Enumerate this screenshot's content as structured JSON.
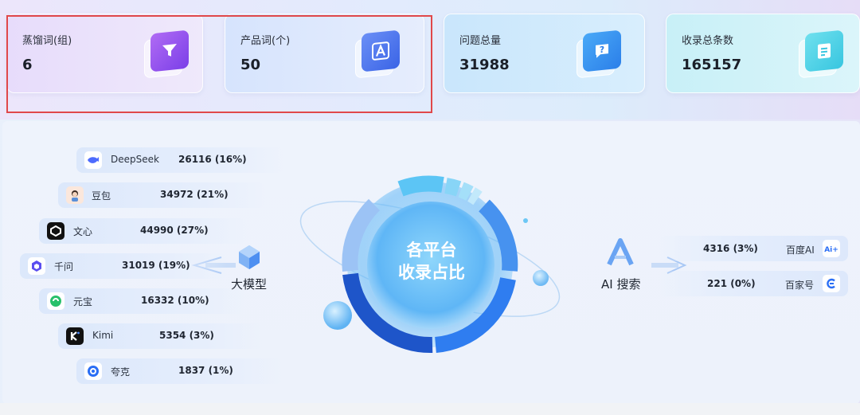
{
  "stats": [
    {
      "label": "蒸馏词(组)",
      "value": "6",
      "icon": "filter-icon"
    },
    {
      "label": "产品词(个)",
      "value": "50",
      "icon": "letter-a-icon"
    },
    {
      "label": "问题总量",
      "value": "31988",
      "icon": "question-icon"
    },
    {
      "label": "收录总条数",
      "value": "165157",
      "icon": "document-icon"
    }
  ],
  "center": {
    "line1": "各平台",
    "line2": "收录占比"
  },
  "left_group": {
    "label": "大模型",
    "platforms": [
      {
        "name": "DeepSeek",
        "value": "26116 (16%)",
        "icon": "deepseek-whale-icon"
      },
      {
        "name": "豆包",
        "value": "34972 (21%)",
        "icon": "doubao-avatar-icon"
      },
      {
        "name": "文心",
        "value": "44990 (27%)",
        "icon": "wenxin-icon"
      },
      {
        "name": "千问",
        "value": "31019 (19%)",
        "icon": "qianwen-icon"
      },
      {
        "name": "元宝",
        "value": "16332 (10%)",
        "icon": "yuanbao-icon"
      },
      {
        "name": "Kimi",
        "value": "5354 (3%)",
        "icon": "kimi-icon"
      },
      {
        "name": "夸克",
        "value": "1837 (1%)",
        "icon": "kuake-icon"
      }
    ]
  },
  "right_group": {
    "label": "AI 搜索",
    "platforms": [
      {
        "name": "百度AI",
        "value": "4316 (3%)",
        "icon": "baidu-ai-icon"
      },
      {
        "name": "百家号",
        "value": "221 (0%)",
        "icon": "baijiahao-icon"
      }
    ]
  },
  "colors": {
    "highlight": "#e0484a",
    "ring_dark": "#1f5fd6",
    "ring_mid": "#3d86ef",
    "ring_light": "#62c3f4"
  }
}
